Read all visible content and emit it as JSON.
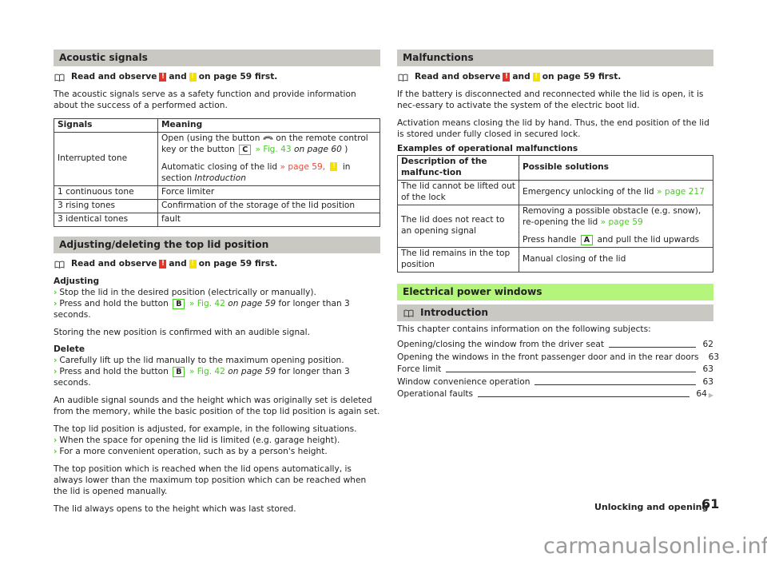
{
  "read_observe": {
    "pre": "Read and observe",
    "mid": "and",
    "post": "on page 59 first.",
    "warn_symbol": "!"
  },
  "left": {
    "acoustic": {
      "title": "Acoustic signals",
      "intro": "The acoustic signals serve as a safety function and provide information about the success of a performed action.",
      "table": {
        "headers": [
          "Signals",
          "Meaning"
        ],
        "row1": {
          "signal": "Interrupted tone",
          "m1_a": "Open (using the button",
          "m1_b": "on the remote control key or the button",
          "m1_key": "C",
          "m1_link": "» Fig. 43",
          "m1_page": "on page 60",
          "m1_end": ")",
          "m2_a": "Automatic closing of the lid",
          "m2_link": "» page 59,",
          "m2_b": "in section",
          "m2_it": "Introduction"
        },
        "rows": [
          {
            "signal": "1 continuous tone",
            "meaning": "Force limiter"
          },
          {
            "signal": "3 rising tones",
            "meaning": "Confirmation of the storage of the lid position"
          },
          {
            "signal": "3 identical tones",
            "meaning": "fault"
          }
        ]
      }
    },
    "adjusting": {
      "title": "Adjusting/deleting the top lid position",
      "adjusting_label": "Adjusting",
      "adj_step1": "Stop the lid in the desired position (electrically or manually).",
      "press_a": "Press and hold the button",
      "press_key": "B",
      "press_link": "» Fig. 42",
      "press_page": "on page 59",
      "press_b": "for longer than 3 seconds.",
      "adj_note": "Storing the new position is confirmed with an audible signal.",
      "delete_label": "Delete",
      "del_step1": "Carefully lift up the lid manually to the maximum opening position.",
      "del_note": "An audible signal sounds and the height which was originally set is deleted from the memory, while the basic position of the top lid position is again set.",
      "situations_intro": "The top lid position is adjusted, for example, in the following situations.",
      "situation1": "When the space for opening the lid is limited (e.g. garage height).",
      "situation2": "For a more convenient operation, such as by a person's height.",
      "top_pos": "The top position which is reached when the lid opens automatically, is always lower than the maximum top position which can be reached when the lid is opened manually.",
      "last_stored": "The lid always opens to the height which was last stored."
    }
  },
  "right": {
    "malfunctions": {
      "title": "Malfunctions",
      "p1": "If the battery is disconnected and reconnected while the lid is open, it is nec-essary to activate the system of the electric boot lid.",
      "p2": "Activation means closing the lid by hand. Thus, the end position of the lid is stored under fully closed in secured lock.",
      "examples_label": "Examples of operational malfunctions",
      "table": {
        "headers": [
          "Description of the malfunc-tion",
          "Possible solutions"
        ],
        "r1_desc": "The lid cannot be lifted out of the lock",
        "r1_sol": "Emergency unlocking of the lid",
        "r1_link": "» page 217",
        "r2_desc": "The lid does not react to an opening signal",
        "r2_sol_a": "Removing a possible obstacle (e.g. snow), re-opening the lid",
        "r2_link": "» page 59",
        "r2_sol_b1": "Press handle",
        "r2_key": "A",
        "r2_sol_b2": "and pull the lid upwards",
        "r3_desc": "The lid remains in the top position",
        "r3_sol": "Manual closing of the lid"
      }
    },
    "windows": {
      "title": "Electrical power windows",
      "intro_title": "Introduction",
      "intro_text": "This chapter contains information on the following subjects:",
      "toc": [
        {
          "title": "Opening/closing the window from the driver seat",
          "page": "62"
        },
        {
          "title": "Opening the windows in the front passenger door and in the rear doors",
          "page": "63"
        },
        {
          "title": "Force limit",
          "page": "63"
        },
        {
          "title": "Window convenience operation",
          "page": "63"
        },
        {
          "title": "Operational faults",
          "page": "64"
        }
      ]
    }
  },
  "footer": {
    "chapter": "Unlocking and opening",
    "page": "61"
  },
  "watermark": "carmanualsonline.info",
  "colors": {
    "accent_green": "#4cc92a",
    "heading_green": "#b4f57c",
    "heading_gray": "#c9c8c3",
    "warning_red": "#e4342a",
    "caution_yellow": "#f7e000"
  }
}
